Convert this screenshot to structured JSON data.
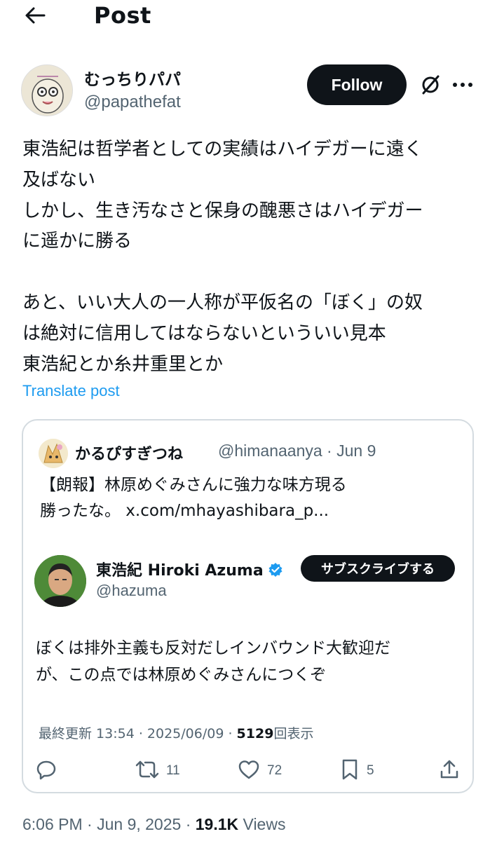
{
  "header": {
    "title": "Post"
  },
  "author": {
    "name": "むっちりパパ",
    "handle": "@papathefat",
    "follow_label": "Follow"
  },
  "post": {
    "lines": [
      "東浩紀は哲学者としての実績はハイデガーに遠く",
      "及ばない",
      "しかし、生き汚なさと保身の醜悪さはハイデガー",
      "に遥かに勝る",
      "",
      "あと、いい大人の一人称が平仮名の「ぼく」の奴",
      "は絶対に信用してはならないといういい見本",
      "東浩紀とか糸井重里とか"
    ],
    "translate_label": "Translate post"
  },
  "quote": {
    "name": "かるぴすぎつね",
    "handle_date": "@himanaanya · Jun 9",
    "lines": [
      "【朗報】林原めぐみさんに強力な味方現る",
      "勝ったな。  x.com/mhayashibara_p..."
    ],
    "embedded": {
      "name": "東浩紀 Hiroki Azuma",
      "handle": "@hazuma",
      "subscribe_label": "サブスクライブする",
      "lines": [
        "ぼくは排外主義も反対だしインバウンド大歓迎だ",
        "が、この点では林原めぐみさんにつくぞ"
      ],
      "meta_prefix": "最終更新 13:54 · 2025/06/09  · ",
      "views_count": "5129",
      "views_label": "回表示"
    },
    "actions": {
      "reposts": "11",
      "likes": "72",
      "bookmarks": "5"
    }
  },
  "footer": {
    "time": "6:06 PM · Jun 9, 2025 · ",
    "views": "19.1K",
    "views_label": " Views"
  }
}
